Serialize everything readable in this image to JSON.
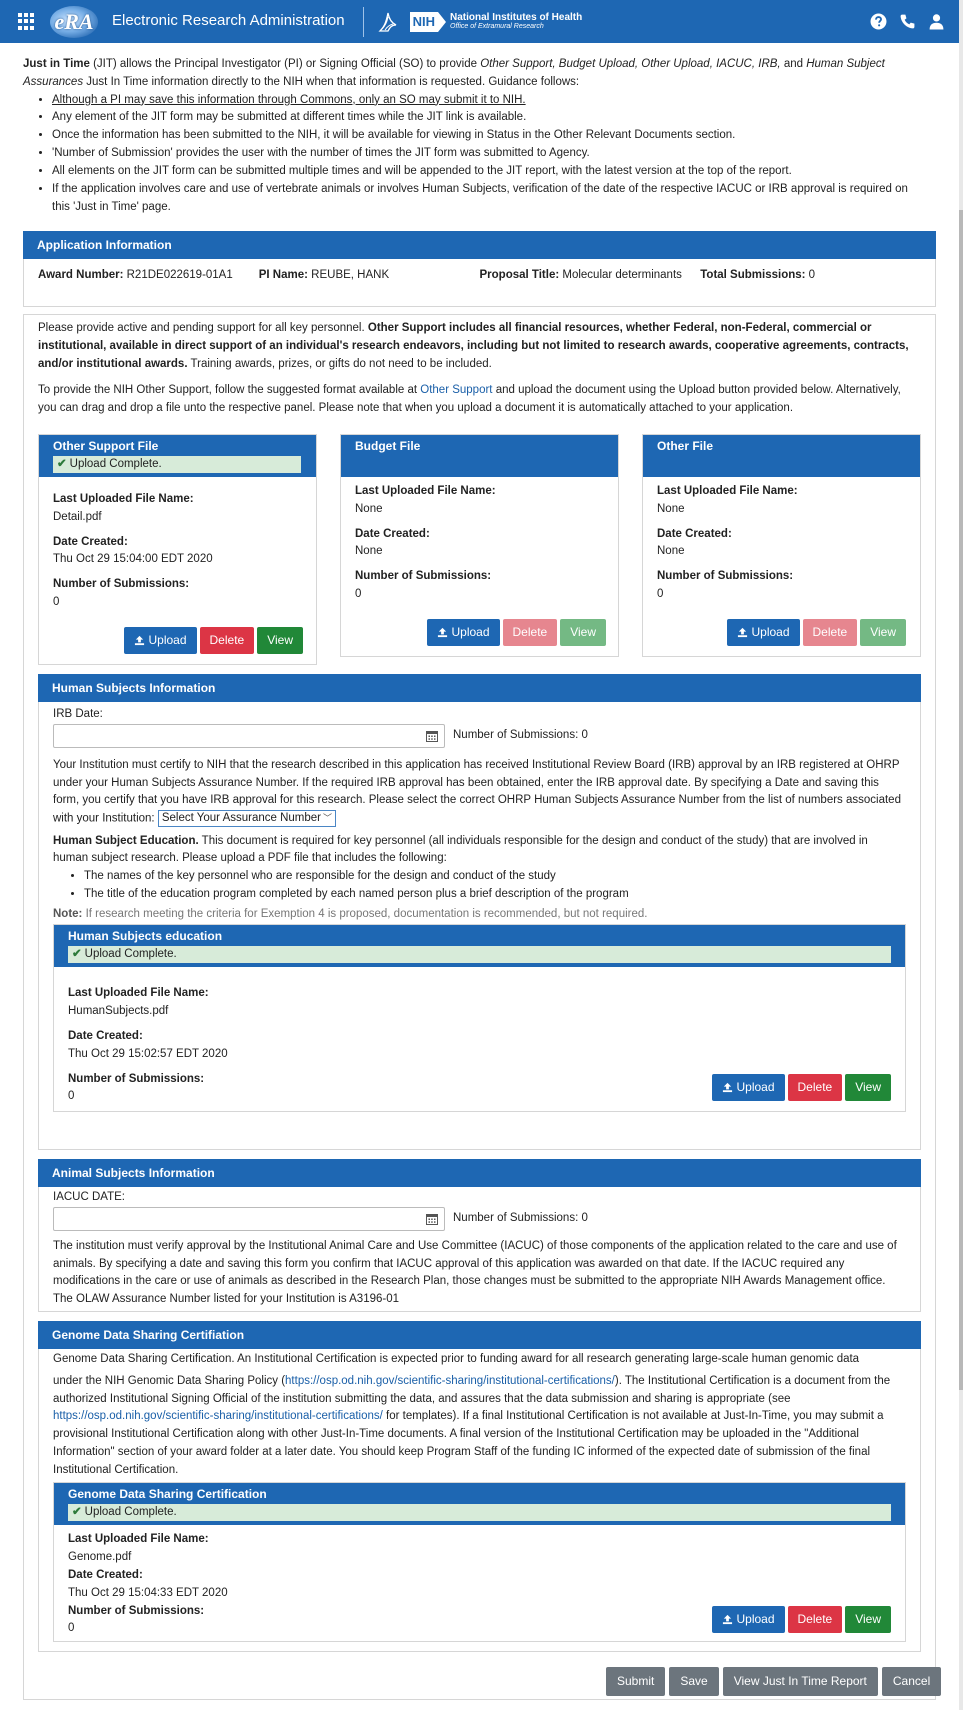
{
  "header": {
    "logo_text": "eRA",
    "app_title": "Electronic Research Administration",
    "nih_box": "NIH",
    "nih_line1": "National Institutes of Health",
    "nih_line2": "Office of Extramural Research"
  },
  "intro": {
    "p1_a": "Just in Time",
    "p1_b": " (JIT) allows the Principal Investigator (PI) or Signing Official (SO) to provide ",
    "p1_c": "Other Support, Budget Upload, Other Upload, IACUC, IRB,",
    "p1_d": " and ",
    "p1_e": "Human Subject Assurances",
    "p1_f": " Just In Time information directly to the NIH when that information is requested.  Guidance follows:",
    "bullets": [
      "Although a PI may save this information through Commons, only an SO may submit it to NIH.",
      "Any element of the JIT form may be submitted at different times while the JIT link is available.",
      "Once the information has been submitted to the NIH, it will be available for viewing in Status in the Other Relevant Documents section.",
      "'Number of Submission' provides the user with the number of times the JIT form was submitted to Agency.",
      "All elements on the JIT form can be submitted multiple times and will be appended to the JIT report, with the latest version at the top of the report.",
      "If the application involves care and use of vertebrate animals or involves Human Subjects, verification of the date of the respective IACUC or IRB approval is required on this 'Just in Time' page."
    ]
  },
  "app_info": {
    "title": "Application Information",
    "award_label": "Award Number:",
    "award_value": " R21DE022619-01A1",
    "pi_label": "PI Name:",
    "pi_value": " REUBE,  HANK",
    "proposal_label": "Proposal Title:",
    "proposal_value": " Molecular determinants",
    "total_label": "Total Submissions:",
    "total_value": " 0"
  },
  "other_support": {
    "p1_a": "Please provide active and pending support for all key personnel. ",
    "p1_b": "Other Support includes all financial resources, whether Federal, non-Federal, commercial or institutional, available in direct support of an individual's research endeavors, including but not limited to research awards, cooperative agreements, contracts, and/or institutional awards.",
    "p1_c": " Training awards, prizes, or gifts do not need to be included.",
    "p2_a": "To provide the NIH Other Support, follow the suggested format available at ",
    "p2_link": "Other Support",
    "p2_b": " and upload the document using the Upload button provided below. Alternatively, you can drag and drop a file unto the respective panel. Please note that when you upload a document it is automatically attached to your application."
  },
  "labels": {
    "last_file": "Last Uploaded File Name:",
    "date_created": "Date Created:",
    "num_submissions": "Number of Submissions:",
    "upload": "Upload",
    "delete": "Delete",
    "view": "View",
    "upload_complete": "Upload Complete."
  },
  "files": {
    "other_support": {
      "title": "Other Support File",
      "file": "Detail.pdf",
      "date": "Thu Oct 29 15:04:00 EDT 2020",
      "count": "0"
    },
    "budget": {
      "title": "Budget File",
      "file": "None",
      "date": "None",
      "count": "0"
    },
    "other": {
      "title": "Other File",
      "file": "None",
      "date": "None",
      "count": "0"
    }
  },
  "human": {
    "title": "Human Subjects Information",
    "irb_label": "IRB Date:",
    "num_sub": "Number of Submissions: 0",
    "para1": "Your Institution must certify to NIH that the research described in this application has received Institutional Review Board (IRB) approval by an IRB registered at OHRP under your Human Subjects Assurance Number. If the required IRB approval has been obtained, enter the IRB approval date. By specifying a Date and saving this form, you certify that you have IRB approval for this research. Please select the correct OHRP Human Subjects Assurance Number from the list of numbers associated with your Institution: ",
    "assurance_select": "Select Your Assurance Number",
    "edu_bold": "Human Subject Education.",
    "edu_text": " This document is required for key personnel (all individuals responsible for the design and conduct of the study) that are involved in human subject research. Please upload a PDF file that includes the following:",
    "edu_bullets": [
      "The names of the key personnel who are responsible for the design and conduct of the study",
      "The title of the education program completed by each named person plus a brief description of the program"
    ],
    "note_label": "Note:",
    "note_text": " If research meeting the criteria for Exemption 4 is proposed, documentation is recommended, but not required.",
    "card_title": "Human Subjects education",
    "file": "HumanSubjects.pdf",
    "date": "Thu Oct 29 15:02:57 EDT 2020",
    "count": "0"
  },
  "animal": {
    "title": "Animal Subjects Information",
    "iacuc_label": "IACUC DATE:",
    "num_sub": "Number of Submissions: 0",
    "para": "The institution must verify approval by the Institutional Animal Care and Use Committee (IACUC) of those components of the application related to the care and use of animals. By specifying a date and saving this form you confirm that IACUC approval of this application was awarded on that date. If the IACUC required any modifications in the care or use of animals as described in the Research Plan, those changes must be submitted to the appropriate NIH Awards Management office. The OLAW Assurance Number listed for your Institution is A3196-01"
  },
  "genome": {
    "title": "Genome Data Sharing Certifiation",
    "para1": "Genome Data Sharing Certification. An Institutional Certification is expected prior to funding award for all research generating large-scale human genomic data",
    "para2_a": "under the NIH Genomic Data Sharing Policy (",
    "link1": "https://osp.od.nih.gov/scientific-sharing/institutional-certifications/",
    "para2_b": "). The Institutional Certification is a document from the authorized Institutional Signing Official of the institution submitting the data, and assures that the data submission and sharing is appropriate (see ",
    "link2": "https://osp.od.nih.gov/scientific-sharing/institutional-certifications/",
    "para2_c": " for templates). If a final Institutional Certification is not available at Just-In-Time, you may submit a provisional Institutional Certification along with other Just-In-Time documents. A final version of the Institutional Certification may be uploaded in the \"Additional Information\" section of your award folder at a later date. You should keep Program Staff of the funding IC informed of the expected date of submission of the final Institutional Certification.",
    "card_title": "Genome Data Sharing Certification",
    "file": "Genome.pdf",
    "date": "Thu Oct 29 15:04:33 EDT 2020",
    "count": "0"
  },
  "actions": {
    "submit": "Submit",
    "save": "Save",
    "report": "View Just In Time Report",
    "cancel": "Cancel"
  }
}
